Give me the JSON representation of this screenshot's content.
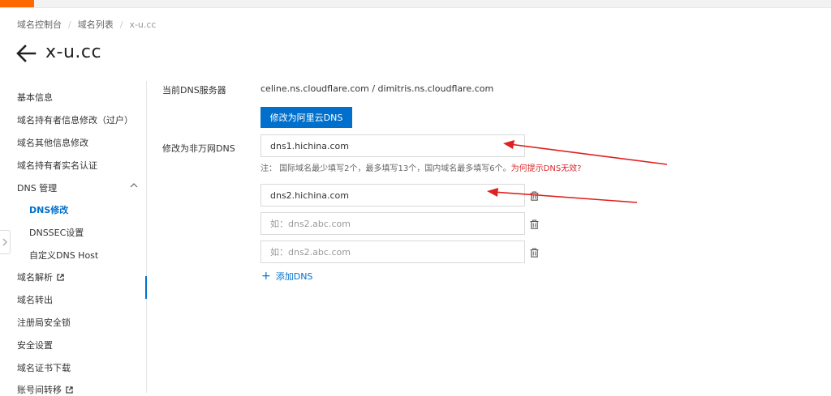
{
  "breadcrumb": {
    "item1": "域名控制台",
    "item2": "域名列表",
    "current": "x-u.cc",
    "separator": "/"
  },
  "page": {
    "title": "x-u.cc"
  },
  "sidebar": {
    "items": [
      {
        "label": "基本信息"
      },
      {
        "label": "域名持有者信息修改（过户）"
      },
      {
        "label": "域名其他信息修改"
      },
      {
        "label": "域名持有者实名认证"
      },
      {
        "label": "DNS 管理"
      },
      {
        "label": "DNS修改"
      },
      {
        "label": "DNSSEC设置"
      },
      {
        "label": "自定义DNS Host"
      },
      {
        "label": "域名解析"
      },
      {
        "label": "域名转出"
      },
      {
        "label": "注册局安全锁"
      },
      {
        "label": "安全设置"
      },
      {
        "label": "域名证书下载"
      },
      {
        "label": "账号间转移"
      }
    ]
  },
  "main": {
    "current_dns_label": "当前DNS服务器",
    "current_dns_value": "celine.ns.cloudflare.com / dimitris.ns.cloudflare.com",
    "switch_button_label": "修改为阿里云DNS",
    "non_wanwang_label": "修改为非万网DNS",
    "dns1_value": "dns1.hichina.com",
    "note_prefix": "注：  国际域名最少填写2个，最多填写13个，国内域名最多填写6个。",
    "note_link": "为何提示DNS无效?",
    "dns2_value": "dns2.hichina.com",
    "dns3_placeholder": "如：dns2.abc.com",
    "dns4_placeholder": "如：dns2.abc.com",
    "add_dns_label": "添加DNS"
  },
  "colors": {
    "accent": "#0070cc",
    "brand": "#ff6a00",
    "annotation": "#e02020",
    "link_red": "#d9262c"
  }
}
